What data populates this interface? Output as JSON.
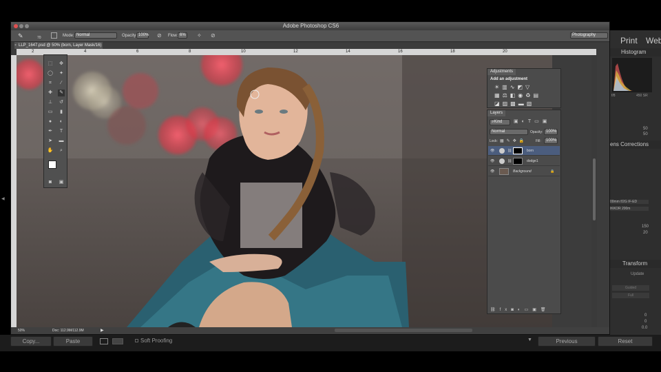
{
  "window_title": "Adobe Photoshop CS6",
  "lightroom": {
    "top_nav": [
      "Print",
      "Web"
    ],
    "panel_headers": {
      "histogram": "Histogram",
      "lens": "ens Corrections",
      "transform": "Transform"
    },
    "histogram_values": [
      "f/8",
      "450 SR"
    ],
    "sliders": [
      {
        "value": "50"
      },
      {
        "value": "50"
      },
      {
        "value": "150"
      },
      {
        "value": "20"
      },
      {
        "value": "0"
      },
      {
        "value": "0"
      },
      {
        "value": "0.0"
      }
    ],
    "lens_profiles": [
      "00mm f/2G IF-ED",
      "IKKOR 200m"
    ],
    "buttons": {
      "update": "Update",
      "guided": "Guided",
      "full": "Full"
    },
    "bottom": {
      "copy": "Copy...",
      "paste": "Paste",
      "soft_proofing": "Soft Proofing",
      "previous": "Previous",
      "reset": "Reset"
    }
  },
  "options_bar": {
    "mode_label": "Mode:",
    "mode_value": "Normal",
    "opacity_label": "Opacity:",
    "opacity_value": "100%",
    "flow_label": "Flow:",
    "flow_value": "6%",
    "brush_size": "70",
    "workspace": "Photography"
  },
  "document": {
    "tab_label": "LLP_1647.psd @ 50% (born, Layer Mask/16)",
    "zoom": "50%",
    "doc_info": "Doc: 112.9M/112.9M"
  },
  "ruler_ticks": [
    "2",
    "4",
    "6",
    "8",
    "10",
    "12",
    "14",
    "16",
    "18",
    "20"
  ],
  "panels": {
    "adjustments": {
      "tab": "Adjustments",
      "header": "Add an adjustment"
    },
    "layers": {
      "tab": "Layers",
      "filter": "Kind",
      "blend_mode": "Normal",
      "opacity_label": "Opacity:",
      "opacity_value": "100%",
      "lock_label": "Lock:",
      "fill_label": "Fill:",
      "fill_value": "100%",
      "items": [
        {
          "name": "born",
          "selected": true
        },
        {
          "name": "dodge1",
          "selected": false
        },
        {
          "name": "Background",
          "selected": false
        }
      ]
    }
  },
  "colors": {
    "ps_bg": "#3c3c3c",
    "panel": "#4b4b4b",
    "selected_layer": "#4b5d7e"
  }
}
